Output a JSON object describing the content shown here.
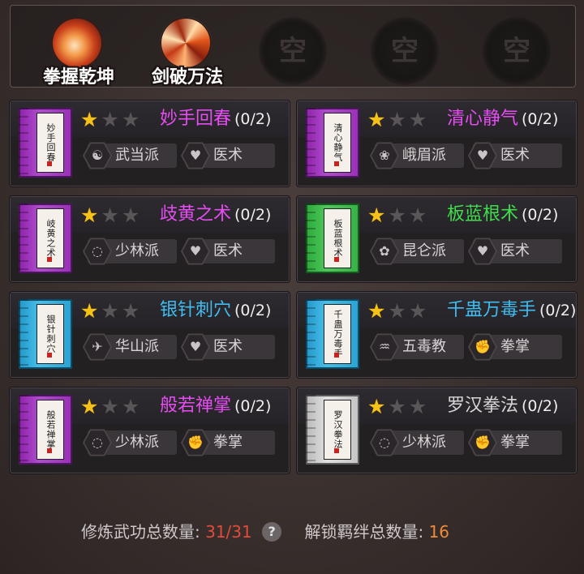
{
  "equipped_skills": [
    {
      "label": "拳握乾坤",
      "icon": "swirl-fist-skill-icon"
    },
    {
      "label": "剑破万法",
      "icon": "sword-burst-skill-icon"
    }
  ],
  "empty_slots": [
    "空",
    "空",
    "空"
  ],
  "cards": [
    {
      "name": "妙手回春",
      "book_title": "妙手回春",
      "progress": "(0/2)",
      "stars": 1,
      "max_stars": 3,
      "name_color": "#e64df2",
      "book_color": "purple",
      "sect": "武当派",
      "sect_icon": "taiji-icon",
      "type": "医术",
      "type_icon": "heart-hands-icon"
    },
    {
      "name": "清心静气",
      "book_title": "清心静气",
      "progress": "(0/2)",
      "stars": 1,
      "max_stars": 3,
      "name_color": "#e64df2",
      "book_color": "purple",
      "sect": "峨眉派",
      "sect_icon": "lotus-icon",
      "type": "医术",
      "type_icon": "heart-hands-icon"
    },
    {
      "name": "歧黄之术",
      "book_title": "岐黄之术",
      "progress": "(0/2)",
      "stars": 1,
      "max_stars": 3,
      "name_color": "#e64df2",
      "book_color": "purple",
      "sect": "少林派",
      "sect_icon": "prayer-beads-icon",
      "type": "医术",
      "type_icon": "heart-hands-icon"
    },
    {
      "name": "板蓝根术",
      "book_title": "板蓝根术",
      "progress": "(0/2)",
      "stars": 1,
      "max_stars": 3,
      "name_color": "#3fdc4b",
      "book_color": "green",
      "sect": "昆仑派",
      "sect_icon": "flower-icon",
      "type": "医术",
      "type_icon": "heart-hands-icon"
    },
    {
      "name": "银针刺穴",
      "book_title": "银针刺穴",
      "progress": "(0/2)",
      "stars": 1,
      "max_stars": 3,
      "name_color": "#3fbdf0",
      "book_color": "blue",
      "sect": "华山派",
      "sect_icon": "crane-icon",
      "type": "医术",
      "type_icon": "heart-hands-icon"
    },
    {
      "name": "千蛊万毒手",
      "book_title": "千蛊万毒手",
      "progress": "(0/2)",
      "stars": 1,
      "max_stars": 3,
      "name_color": "#3fbdf0",
      "book_color": "blue",
      "sect": "五毒教",
      "sect_icon": "scorpion-icon",
      "type": "拳掌",
      "type_icon": "fist-icon"
    },
    {
      "name": "般若禅掌",
      "book_title": "般若禅掌",
      "progress": "(0/2)",
      "stars": 1,
      "max_stars": 3,
      "name_color": "#e64df2",
      "book_color": "purple",
      "sect": "少林派",
      "sect_icon": "prayer-beads-icon",
      "type": "拳掌",
      "type_icon": "fist-icon"
    },
    {
      "name": "罗汉拳法",
      "book_title": "罗汉拳法",
      "progress": "(0/2)",
      "stars": 1,
      "max_stars": 3,
      "name_color": "#d9d5d7",
      "book_color": "gray",
      "sect": "少林派",
      "sect_icon": "prayer-beads-icon",
      "type": "拳掌",
      "type_icon": "fist-icon"
    }
  ],
  "footer": {
    "trained_label": "修炼武功总数量:",
    "trained_value": "31/31",
    "help": "?",
    "bonds_label": "解锁羁绊总数量:",
    "bonds_value": "16"
  }
}
